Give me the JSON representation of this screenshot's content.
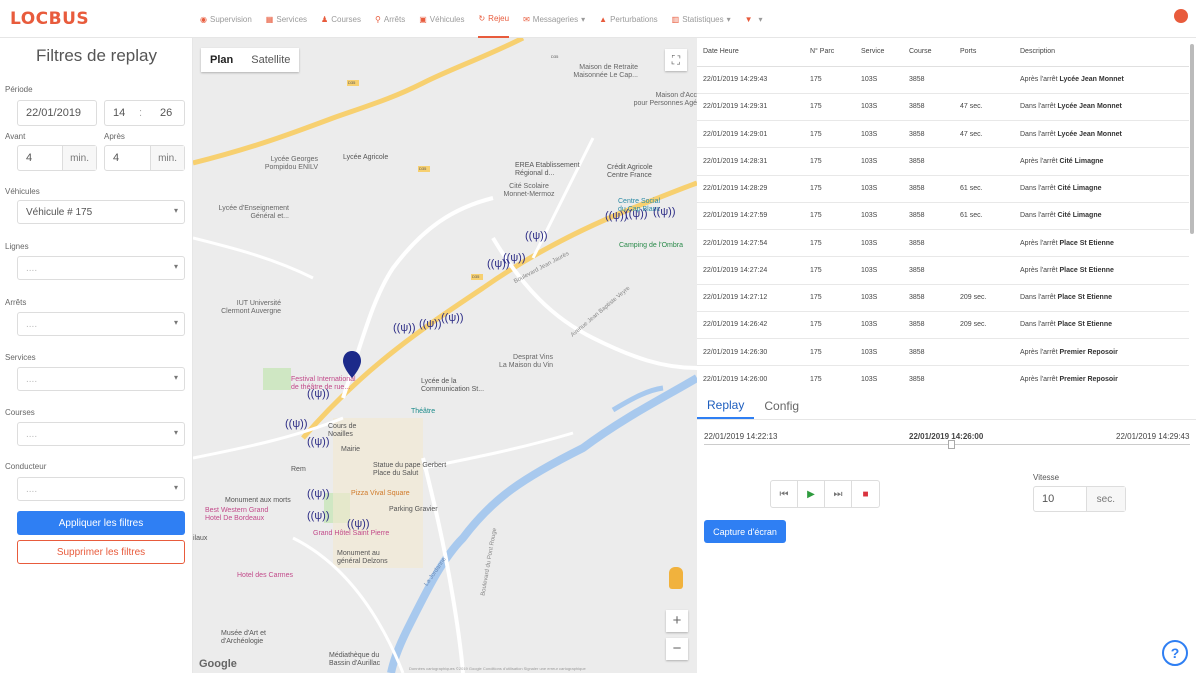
{
  "app": {
    "logo": "LOCBUS"
  },
  "nav": {
    "items": [
      {
        "label": "Supervision",
        "icon": "eye-icon",
        "glyph": "◉"
      },
      {
        "label": "Services",
        "icon": "calendar-icon",
        "glyph": "▦"
      },
      {
        "label": "Courses",
        "icon": "people-icon",
        "glyph": "♟"
      },
      {
        "label": "Arrêts",
        "icon": "map-pin-icon",
        "glyph": "⚲"
      },
      {
        "label": "Véhicules",
        "icon": "bus-icon",
        "glyph": "▣"
      },
      {
        "label": "Rejeu",
        "icon": "refresh-icon",
        "glyph": "↻"
      },
      {
        "label": "Messageries",
        "icon": "chat-icon",
        "glyph": "✉"
      },
      {
        "label": "Perturbations",
        "icon": "warning-icon",
        "glyph": "▲"
      },
      {
        "label": "Statistiques",
        "icon": "chart-icon",
        "glyph": "▥"
      },
      {
        "label": "",
        "icon": "bell-icon",
        "glyph": "▼"
      }
    ],
    "active_index": 5,
    "dropdown_marker": "▾"
  },
  "filters": {
    "title": "Filtres de replay",
    "periode_label": "Période",
    "date_value": "22/01/2019",
    "hour_value": "14",
    "separator": ":",
    "minute_value": "26",
    "avant_label": "Avant",
    "apres_label": "Après",
    "avant_value": "4",
    "apres_value": "4",
    "min_unit": "min.",
    "vehicules_label": "Véhicules",
    "vehicule_value": "Véhicule # 175",
    "lignes_label": "Lignes",
    "arrets_label": "Arrêts",
    "services_label": "Services",
    "courses_label": "Courses",
    "conducteur_label": "Conducteur",
    "empty_placeholder": "....",
    "apply_label": "Appliquer les filtres",
    "clear_label": "Supprimer les filtres"
  },
  "map": {
    "tab_plan": "Plan",
    "tab_satellite": "Satellite",
    "fullscreen": "⛶",
    "zoom_in": "+",
    "zoom_out": "−",
    "google": "Google",
    "footer": "Données cartographiques ©2019 Google  Conditions d'utilisation  Signaler une erreur cartographique",
    "labels": [
      {
        "text": "Maison de Retraite\nMaisonnée Le Cap..."
      },
      {
        "text": "Maison d'Acc\npour Personnes Agé"
      },
      {
        "text": "Lycée Georges\nPompidou ENILV"
      },
      {
        "text": "Lycée Agricole"
      },
      {
        "text": "EREA Etablissement\nRégional d..."
      },
      {
        "text": "Crédit Agricole\nCentre France"
      },
      {
        "text": "Cité Scolaire\nMonnet-Mermoz"
      },
      {
        "text": "Lycée d'Enseignement\nGénéral et..."
      },
      {
        "text": "Centre Social\ndu Cap Blanc"
      },
      {
        "text": "Camping de l'Ombra"
      },
      {
        "text": "IUT Université\nClermont Auvergne"
      },
      {
        "text": "Desprat Vins\nLa Maison du Vin"
      },
      {
        "text": "Festival International\nde théâtre de rue..."
      },
      {
        "text": "Lycée de la\nCommunication St..."
      },
      {
        "text": "Théâtre"
      },
      {
        "text": "Cours de\nNoailles"
      },
      {
        "text": "Mairie"
      },
      {
        "text": "Statue du pape Gerbert\nPlace du Salut"
      },
      {
        "text": "Pizza Vival Square"
      },
      {
        "text": "Monument aux morts"
      },
      {
        "text": "Best Western Grand\nHotel De Bordeaux"
      },
      {
        "text": "Parking Gravier"
      },
      {
        "text": "Grand Hôtel Saint Pierre"
      },
      {
        "text": "Monument au\ngénéral Delzons"
      },
      {
        "text": "Hotel des Carmes"
      },
      {
        "text": "Musée d'Art et\nd'Archéologie"
      },
      {
        "text": "Médiathèque du\nBassin d'Aurillac"
      },
      {
        "text": "Rem"
      },
      {
        "text": "ilaux"
      },
      {
        "text": "Boulevard Jean Jaurès"
      },
      {
        "text": "Avenue Jean Baptiste Veyre"
      },
      {
        "text": "La Jordanne"
      },
      {
        "text": "Boulevard du Pont Rouge"
      },
      {
        "text": "D35"
      },
      {
        "text": "D35"
      },
      {
        "text": "D35"
      },
      {
        "text": "D35"
      }
    ],
    "antenna_glyph": "((ψ))"
  },
  "table": {
    "headers": [
      "Date Heure",
      "N° Parc",
      "Service",
      "Course",
      "Ports",
      "Description"
    ],
    "rows": [
      {
        "date": "22/01/2019 14:29:43",
        "parc": "175",
        "service": "103S",
        "course": "3858",
        "ports": "",
        "desc_prefix": "Après l'arrêt",
        "desc_stop": "Lycée Jean Monnet"
      },
      {
        "date": "22/01/2019 14:29:31",
        "parc": "175",
        "service": "103S",
        "course": "3858",
        "ports": "47 sec.",
        "desc_prefix": "Dans l'arrêt",
        "desc_stop": "Lycée Jean Monnet"
      },
      {
        "date": "22/01/2019 14:29:01",
        "parc": "175",
        "service": "103S",
        "course": "3858",
        "ports": "47 sec.",
        "desc_prefix": "Dans l'arrêt",
        "desc_stop": "Lycée Jean Monnet"
      },
      {
        "date": "22/01/2019 14:28:31",
        "parc": "175",
        "service": "103S",
        "course": "3858",
        "ports": "",
        "desc_prefix": "Après l'arrêt",
        "desc_stop": "Cité Limagne"
      },
      {
        "date": "22/01/2019 14:28:29",
        "parc": "175",
        "service": "103S",
        "course": "3858",
        "ports": "61 sec.",
        "desc_prefix": "Dans l'arrêt",
        "desc_stop": "Cité Limagne"
      },
      {
        "date": "22/01/2019 14:27:59",
        "parc": "175",
        "service": "103S",
        "course": "3858",
        "ports": "61 sec.",
        "desc_prefix": "Dans l'arrêt",
        "desc_stop": "Cité Limagne"
      },
      {
        "date": "22/01/2019 14:27:54",
        "parc": "175",
        "service": "103S",
        "course": "3858",
        "ports": "",
        "desc_prefix": "Après l'arrêt",
        "desc_stop": "Place St Etienne"
      },
      {
        "date": "22/01/2019 14:27:24",
        "parc": "175",
        "service": "103S",
        "course": "3858",
        "ports": "",
        "desc_prefix": "Après l'arrêt",
        "desc_stop": "Place St Etienne"
      },
      {
        "date": "22/01/2019 14:27:12",
        "parc": "175",
        "service": "103S",
        "course": "3858",
        "ports": "209 sec.",
        "desc_prefix": "Dans l'arrêt",
        "desc_stop": "Place St Etienne"
      },
      {
        "date": "22/01/2019 14:26:42",
        "parc": "175",
        "service": "103S",
        "course": "3858",
        "ports": "209 sec.",
        "desc_prefix": "Dans l'arrêt",
        "desc_stop": "Place St Etienne"
      },
      {
        "date": "22/01/2019 14:26:30",
        "parc": "175",
        "service": "103S",
        "course": "3858",
        "ports": "",
        "desc_prefix": "Après l'arrêt",
        "desc_stop": "Premier Reposoir"
      },
      {
        "date": "22/01/2019 14:26:00",
        "parc": "175",
        "service": "103S",
        "course": "3858",
        "ports": "",
        "desc_prefix": "Après l'arrêt",
        "desc_stop": "Premier Reposoir"
      }
    ]
  },
  "replay": {
    "tab_replay": "Replay",
    "tab_config": "Config",
    "start_time": "22/01/2019 14:22:13",
    "current_time": "22/01/2019 14:26:00",
    "end_time": "22/01/2019 14:29:43",
    "btn_prev": "⏮",
    "btn_play": "▶",
    "btn_next": "⏭",
    "btn_stop": "■",
    "vitesse_label": "Vitesse",
    "vitesse_value": "10",
    "vitesse_unit": "sec.",
    "capture_label": "Capture d'écran"
  },
  "help": {
    "glyph": "?"
  },
  "colors": {
    "brand": "#e85b3c",
    "primary": "#2f7ff3",
    "play": "#2e9b3e",
    "stop": "#d9333f",
    "antenna": "#2c2c86",
    "road": "#f7d070"
  }
}
